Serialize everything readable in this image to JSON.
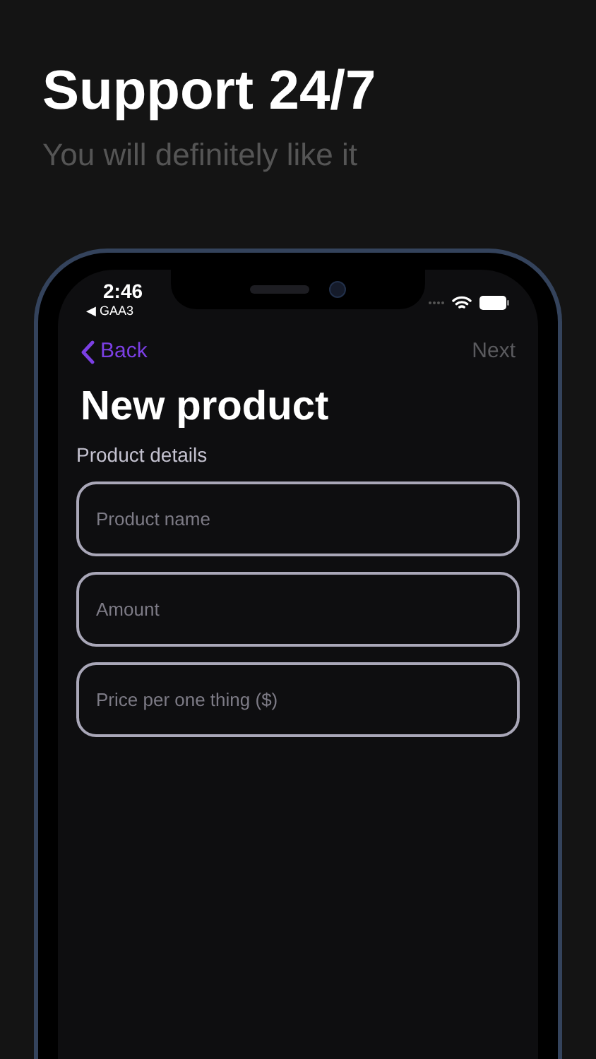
{
  "headline": "Support 24/7",
  "subtitle": "You will definitely like it",
  "status_bar": {
    "time": "2:46",
    "back_app": "◀ GAA3"
  },
  "nav": {
    "back": "Back",
    "next": "Next"
  },
  "title": "New product",
  "section": "Product details",
  "fields": [
    {
      "placeholder": "Product name"
    },
    {
      "placeholder": "Amount"
    },
    {
      "placeholder": "Price per one thing ($)"
    }
  ]
}
